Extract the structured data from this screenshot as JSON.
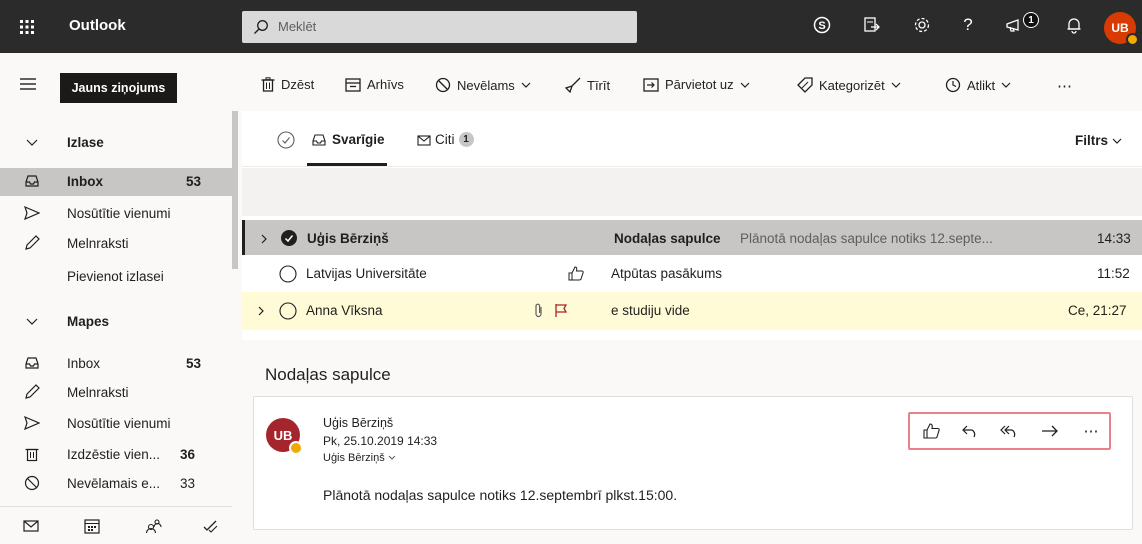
{
  "topbar": {
    "app_name": "Outlook",
    "search_placeholder": "Meklēt",
    "notifications_badge": "1",
    "help_label": "?",
    "avatar_initials": "UB"
  },
  "commands": {
    "new_message": "Jauns ziņojums",
    "delete": "Dzēst",
    "archive": "Arhīvs",
    "junk": "Nevēlams",
    "sweep": "Tīrīt",
    "move_to": "Pārvietot uz",
    "categorize": "Kategorizēt",
    "snooze": "Atlikt",
    "more": "⋯"
  },
  "sidebar": {
    "favorites_header": "Izlase",
    "favorites": [
      {
        "label": "Inbox",
        "count": "53"
      },
      {
        "label": "Nosūtītie vienumi",
        "count": ""
      },
      {
        "label": "Melnraksti",
        "count": ""
      },
      {
        "label": "Pievienot izlasei",
        "count": ""
      }
    ],
    "folders_header": "Mapes",
    "folders": [
      {
        "label": "Inbox",
        "count": "53"
      },
      {
        "label": "Melnraksti",
        "count": ""
      },
      {
        "label": "Nosūtītie vienumi",
        "count": ""
      },
      {
        "label": "Izdzēstie vien...",
        "count": "36"
      },
      {
        "label": "Nevēlamais e...",
        "count": "33"
      }
    ]
  },
  "tabs": {
    "focused": "Svarīgie",
    "other": "Citi",
    "other_count": "1",
    "filter": "Filtrs"
  },
  "messages": [
    {
      "sender": "Uģis Bērziņš",
      "subject": "Nodaļas sapulce",
      "preview": "Plānotā nodaļas sapulce notiks 12.septe...",
      "time": "14:33"
    },
    {
      "sender": "Latvijas Universitāte",
      "subject": "Atpūtas pasākums",
      "preview": "",
      "time": "11:52"
    },
    {
      "sender": "Anna Vīksna",
      "subject": "e studiju vide",
      "preview": "",
      "time": "Ce, 21:27"
    }
  ],
  "reading": {
    "subject": "Nodaļas sapulce",
    "sender": "Uģis Bērziņš",
    "date": "Pk, 25.10.2019 14:33",
    "to": "Uģis Bērziņš",
    "avatar_initials": "UB",
    "body": "Plānotā nodaļas sapulce notiks 12.septembrī plkst.15:00.",
    "more_actions": "⋯"
  },
  "colors": {
    "topbar_bg": "#2b2b2b",
    "selected_row": "#c8c6c4",
    "flagged_row": "#fefbd6",
    "flag": "#a4262c",
    "avatar_top": "#d83b01",
    "avatar_card": "#a4262c",
    "highlight_box": "#e8818a"
  }
}
